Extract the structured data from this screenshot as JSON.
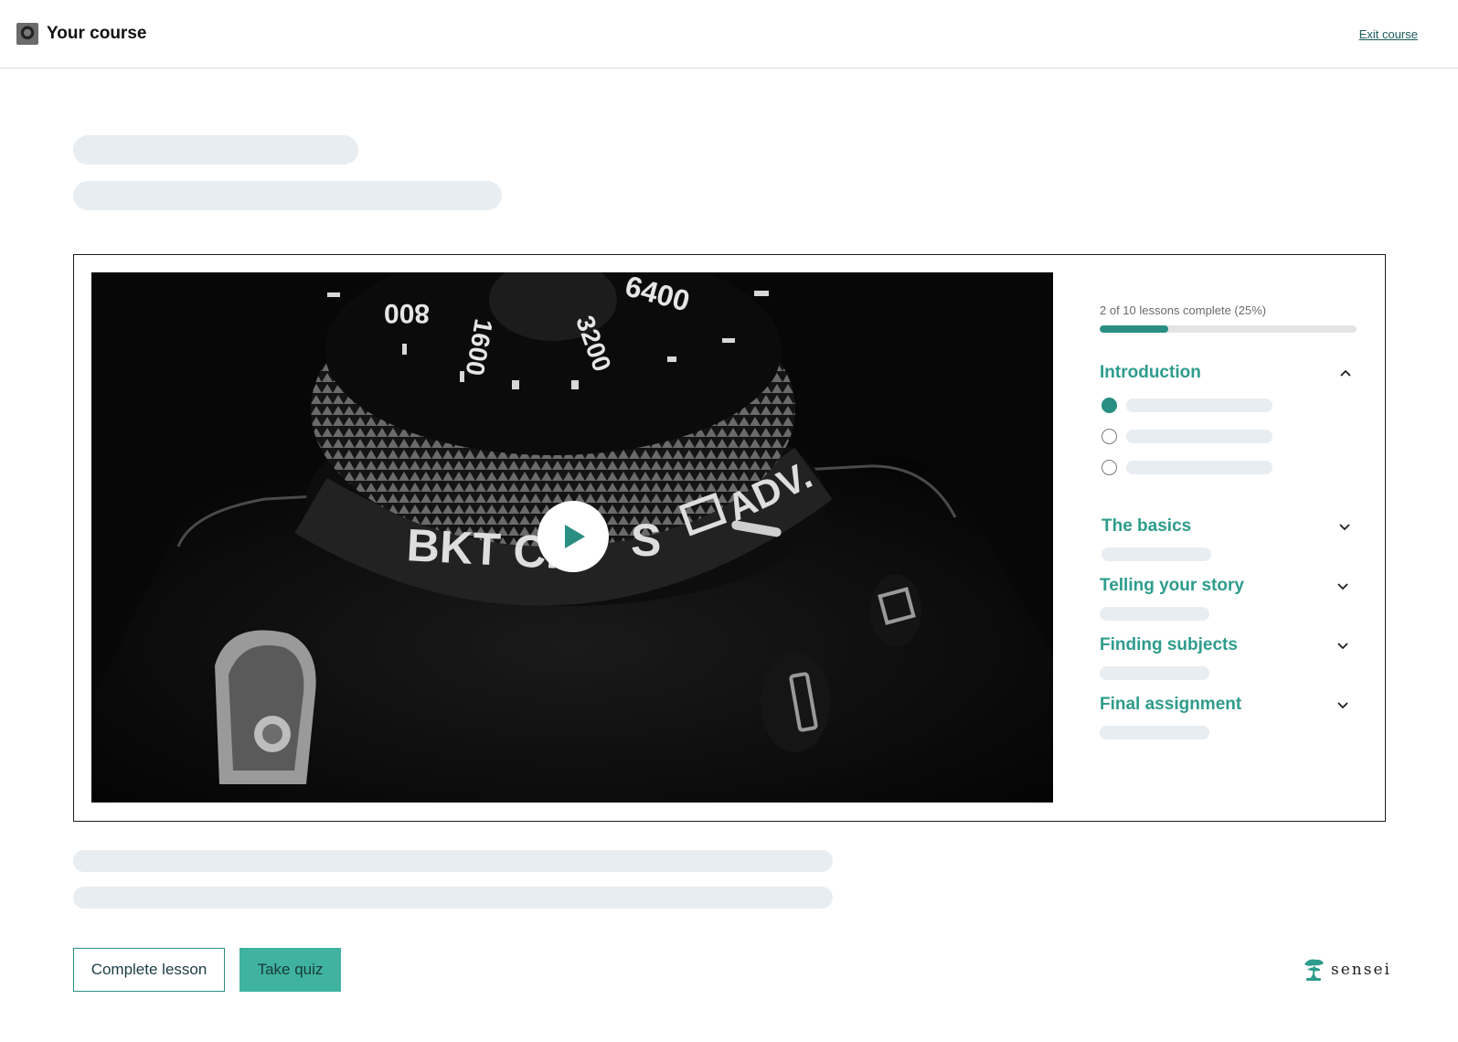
{
  "header": {
    "title": "Your course",
    "exit_label": "Exit course"
  },
  "sidebar": {
    "progress_text": "2 of 10 lessons complete (25%)",
    "progress_fraction": 0.25,
    "modules": [
      {
        "title": "Introduction",
        "expanded": true,
        "lessons": [
          {
            "completed": true
          },
          {
            "completed": false
          },
          {
            "completed": false
          }
        ]
      },
      {
        "title": "The basics",
        "expanded": false
      },
      {
        "title": "Telling your story",
        "expanded": false
      },
      {
        "title": "Finding subjects",
        "expanded": false
      },
      {
        "title": "Final assignment",
        "expanded": false
      }
    ]
  },
  "video": {
    "play_icon": "play-icon"
  },
  "actions": {
    "complete_label": "Complete lesson",
    "quiz_label": "Take quiz"
  },
  "brand": {
    "name": "sensei",
    "icon": "bonsai-tree-icon"
  },
  "colors": {
    "accent": "#2e9c8c",
    "button_fill": "#3fb39f",
    "skeleton": "#e8edf2"
  }
}
